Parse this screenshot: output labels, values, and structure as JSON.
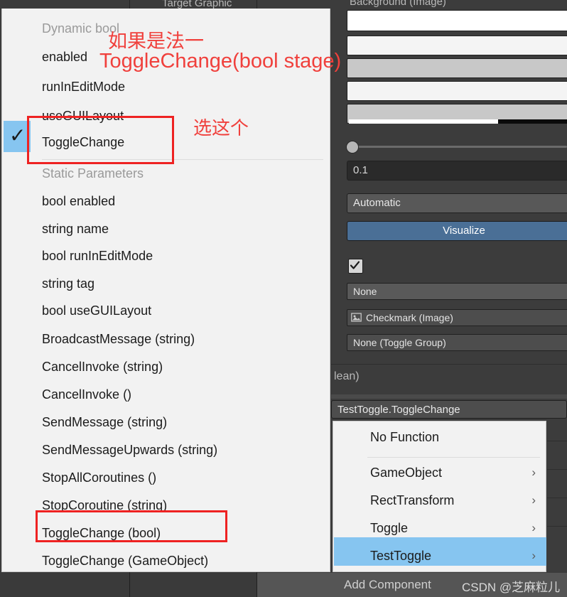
{
  "app": {
    "title": "Unity Inspector — UnityEvent function dropdown",
    "accent_blue": "#86c5f0",
    "annotation_red": "#f0403c",
    "visualize_blue": "#4a6f96"
  },
  "inspector": {
    "header_target_graphic": "Target Graphic",
    "header_background_image": "Background (Image)",
    "fade_duration_value": "0.1",
    "navigation_value": "Automatic",
    "visualize_label": "Visualize",
    "is_on_checkbox_checked": true,
    "none_value": "None",
    "checkmark_value": "Checkmark (Image)",
    "toggle_group_value": "None (Toggle Group)",
    "boolean_partial_label": "lean)",
    "selected_function_label": "TestToggle.ToggleChange",
    "add_component_label": "Add Component",
    "watermark": "CSDN @芝麻粒儿"
  },
  "function_menu": {
    "dynamic_section_label": "Dynamic bool",
    "dynamic_items": [
      "enabled",
      "runInEditMode",
      "useGUILayout",
      "ToggleChange"
    ],
    "selected_dynamic_item": "ToggleChange",
    "static_section_label": "Static Parameters",
    "static_items": [
      "bool enabled",
      "string name",
      "bool runInEditMode",
      "string tag",
      "bool useGUILayout",
      "BroadcastMessage (string)",
      "CancelInvoke (string)",
      "CancelInvoke ()",
      "SendMessage (string)",
      "SendMessageUpwards (string)",
      "StopAllCoroutines ()",
      "StopCoroutine (string)",
      "ToggleChange (bool)",
      "ToggleChange (GameObject)"
    ],
    "highlighted_static_item": "ToggleChange (bool)"
  },
  "component_menu": {
    "items": [
      {
        "label": "No Function",
        "has_submenu": false,
        "highlighted": false
      },
      {
        "label": "GameObject",
        "has_submenu": true,
        "highlighted": false
      },
      {
        "label": "RectTransform",
        "has_submenu": true,
        "highlighted": false
      },
      {
        "label": "Toggle",
        "has_submenu": true,
        "highlighted": false
      },
      {
        "label": "TestToggle",
        "has_submenu": true,
        "highlighted": true
      }
    ],
    "submenu_arrow": "›"
  },
  "annotations": [
    {
      "id": "note-method-one",
      "text": "如果是法一"
    },
    {
      "id": "note-signature",
      "text": "ToggleChange(bool stage)"
    },
    {
      "id": "note-pick-this",
      "text": "选这个"
    }
  ]
}
